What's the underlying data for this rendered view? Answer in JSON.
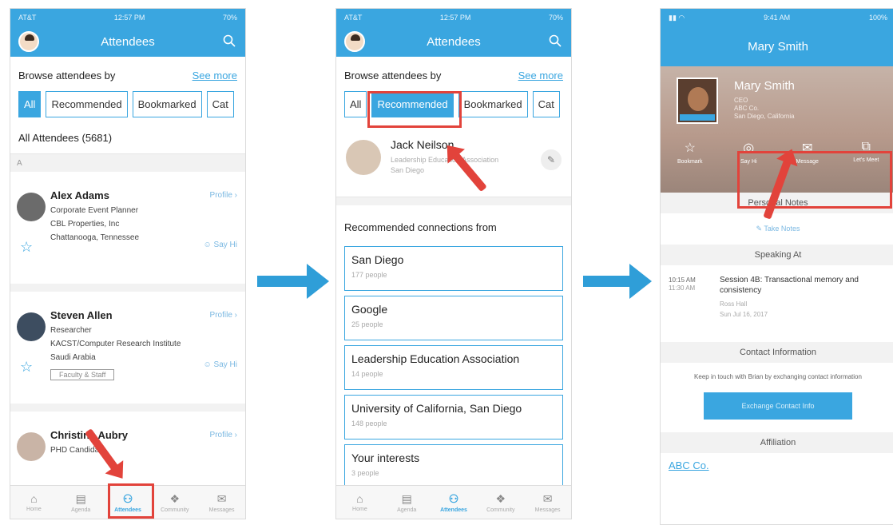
{
  "phone1": {
    "status": {
      "carrier": "AT&T",
      "time": "12:57 PM",
      "battery": "70%"
    },
    "title": "Attendees",
    "browse_label": "Browse attendees by",
    "see_more": "See more",
    "tabs": [
      "All",
      "Recommended",
      "Bookmarked",
      "Cat"
    ],
    "count": "All Attendees (5681)",
    "section": "A",
    "people": [
      {
        "name": "Alex Adams",
        "lines": [
          "Corporate Event Planner",
          "CBL Properties, Inc",
          "Chattanooga, Tennessee"
        ],
        "profile": "Profile",
        "sayhi": "Say Hi",
        "tag": ""
      },
      {
        "name": "Steven Allen",
        "lines": [
          "Researcher",
          "KACST/Computer Research Institute",
          "Saudi Arabia"
        ],
        "profile": "Profile",
        "sayhi": "Say Hi",
        "tag": "Faculty & Staff"
      },
      {
        "name": "Christina Aubry",
        "lines": [
          "PHD Candidate"
        ],
        "profile": "Profile",
        "sayhi": "",
        "tag": ""
      }
    ]
  },
  "phone2": {
    "status": {
      "carrier": "AT&T",
      "time": "12:57 PM",
      "battery": "70%"
    },
    "title": "Attendees",
    "browse_label": "Browse attendees by",
    "see_more": "See more",
    "tabs": [
      "All",
      "Recommended",
      "Bookmarked",
      "Cat"
    ],
    "person": {
      "name": "Jack Neilson",
      "role": "Leadership Education Association",
      "location": "San Diego"
    },
    "rec_title": "Recommended connections from",
    "connections": [
      {
        "name": "San Diego",
        "people": "177 people"
      },
      {
        "name": "Google",
        "people": "25 people"
      },
      {
        "name": "Leadership Education Association",
        "people": "14 people"
      },
      {
        "name": "University of California, San Diego",
        "people": "148 people"
      },
      {
        "name": "Your interests",
        "people": "3 people"
      }
    ]
  },
  "phone3": {
    "status": {
      "time": "9:41 AM",
      "battery": "100%"
    },
    "title": "Mary Smith",
    "profile": {
      "name": "Mary Smith",
      "role": "CEO",
      "company": "ABC Co.",
      "location": "San Diego, California"
    },
    "actions": [
      "Bookmark",
      "Say Hi",
      "Message",
      "Let's Meet"
    ],
    "personal_notes": "Personal Notes",
    "take_notes": "Take Notes",
    "speaking_at": "Speaking At",
    "session": {
      "time_start": "10:15 AM",
      "time_end": "11:30 AM",
      "title": "Session 4B: Transactional memory and consistency",
      "room": "Ross Hall",
      "date": "Sun Jul 16, 2017"
    },
    "contact_info": "Contact Information",
    "contact_text": "Keep in touch with Brian by exchanging contact information",
    "exchange_button": "Exchange Contact Info",
    "affiliation": "Affiliation",
    "affiliation_link": "ABC Co."
  },
  "bottom_tabs": [
    {
      "label": "Home",
      "icon": "home-icon"
    },
    {
      "label": "Agenda",
      "icon": "agenda-icon"
    },
    {
      "label": "Attendees",
      "icon": "attendees-icon"
    },
    {
      "label": "Community",
      "icon": "community-icon"
    },
    {
      "label": "Messages",
      "icon": "messages-icon"
    }
  ],
  "colors": {
    "accent": "#3aa6e0",
    "highlight": "#e2433b",
    "flow_arrow": "#2f9ed8"
  }
}
